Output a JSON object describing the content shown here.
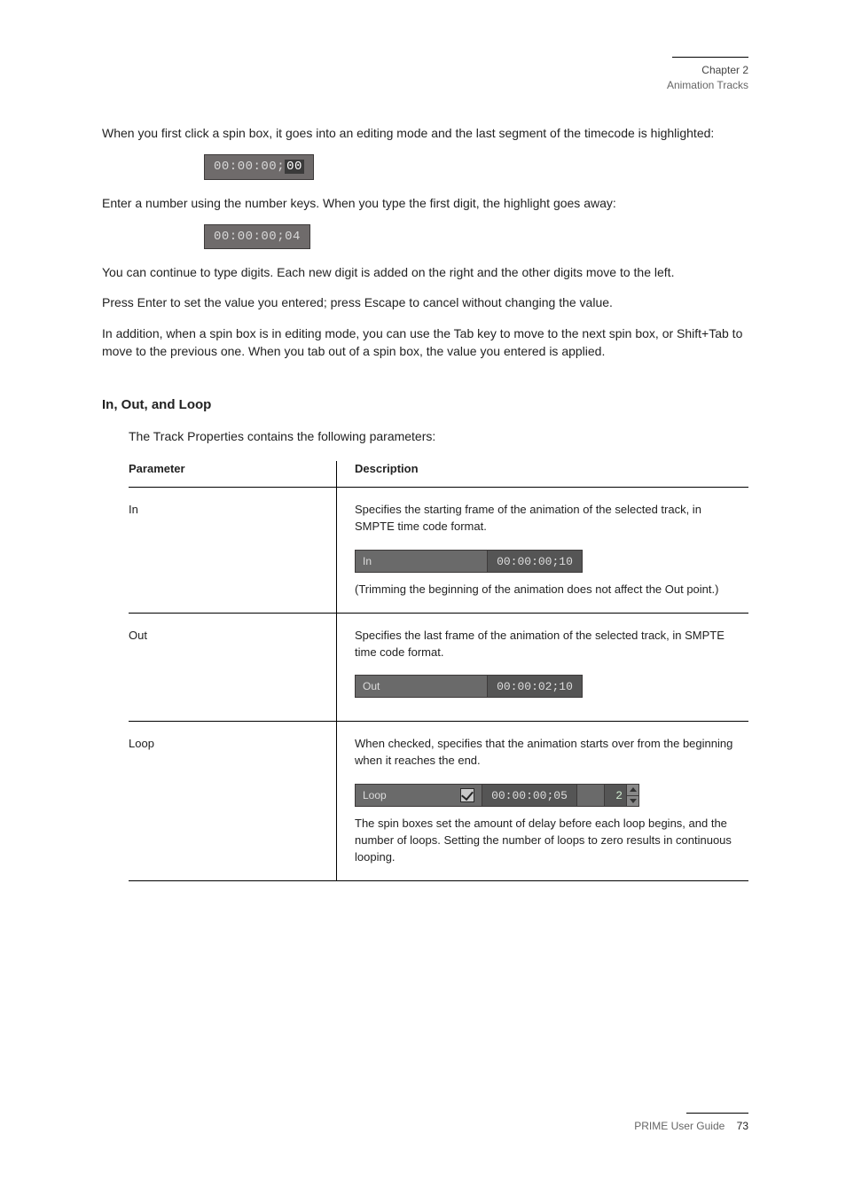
{
  "header": {
    "chapter": "Chapter 2",
    "section": "Animation Tracks"
  },
  "footer": {
    "label": "PRIME User Guide",
    "page": "73"
  },
  "intro": "When you first click a spin box, it goes into an editing mode and the last segment of the timecode is highlighted:",
  "chip1_pre": "00:00:00;",
  "chip1_hl": "00",
  "after_chip1": "Enter a number using the number keys. When you type the first digit, the highlight goes away:",
  "chip2": "00:00:00;04",
  "para_type": "You can continue to type digits. Each new digit is added on the right and the other digits move to the left.",
  "para_enter": "Press Enter to set the value you entered; press Escape to cancel without changing the value.",
  "para_tab": "In addition, when a spin box is in editing mode, you can use the Tab key to move to the next spin box, or Shift+Tab to move to the previous one. When you tab out of a spin box, the value you entered is applied.",
  "subhead": "In, Out, and Loop",
  "subhead_intro": "The Track Properties contains the following parameters:",
  "table": {
    "head_left": "Parameter",
    "head_right": "Description",
    "rows": [
      {
        "name": "In",
        "field": {
          "label": "In",
          "tc": "00:00:00;10"
        },
        "desc1": "Specifies the starting frame of the animation of the selected track, in SMPTE time code format.",
        "desc2": "(Trimming the beginning of the animation does not affect the Out point.)"
      },
      {
        "name": "Out",
        "field": {
          "label": "Out",
          "tc": "00:00:02;10"
        },
        "desc1": "Specifies the last frame of the animation of the selected track, in SMPTE time code format."
      },
      {
        "name": "Loop",
        "field": {
          "label": "Loop",
          "checked": true,
          "tc": "00:00:00;05",
          "count": "2"
        },
        "desc_pre": "When checked, specifies that the animation starts over from the beginning when it reaches the end.",
        "desc_post": "The spin boxes set the amount of delay before each loop begins, and the number of loops. Setting the number of loops to zero results in continuous looping."
      }
    ]
  }
}
